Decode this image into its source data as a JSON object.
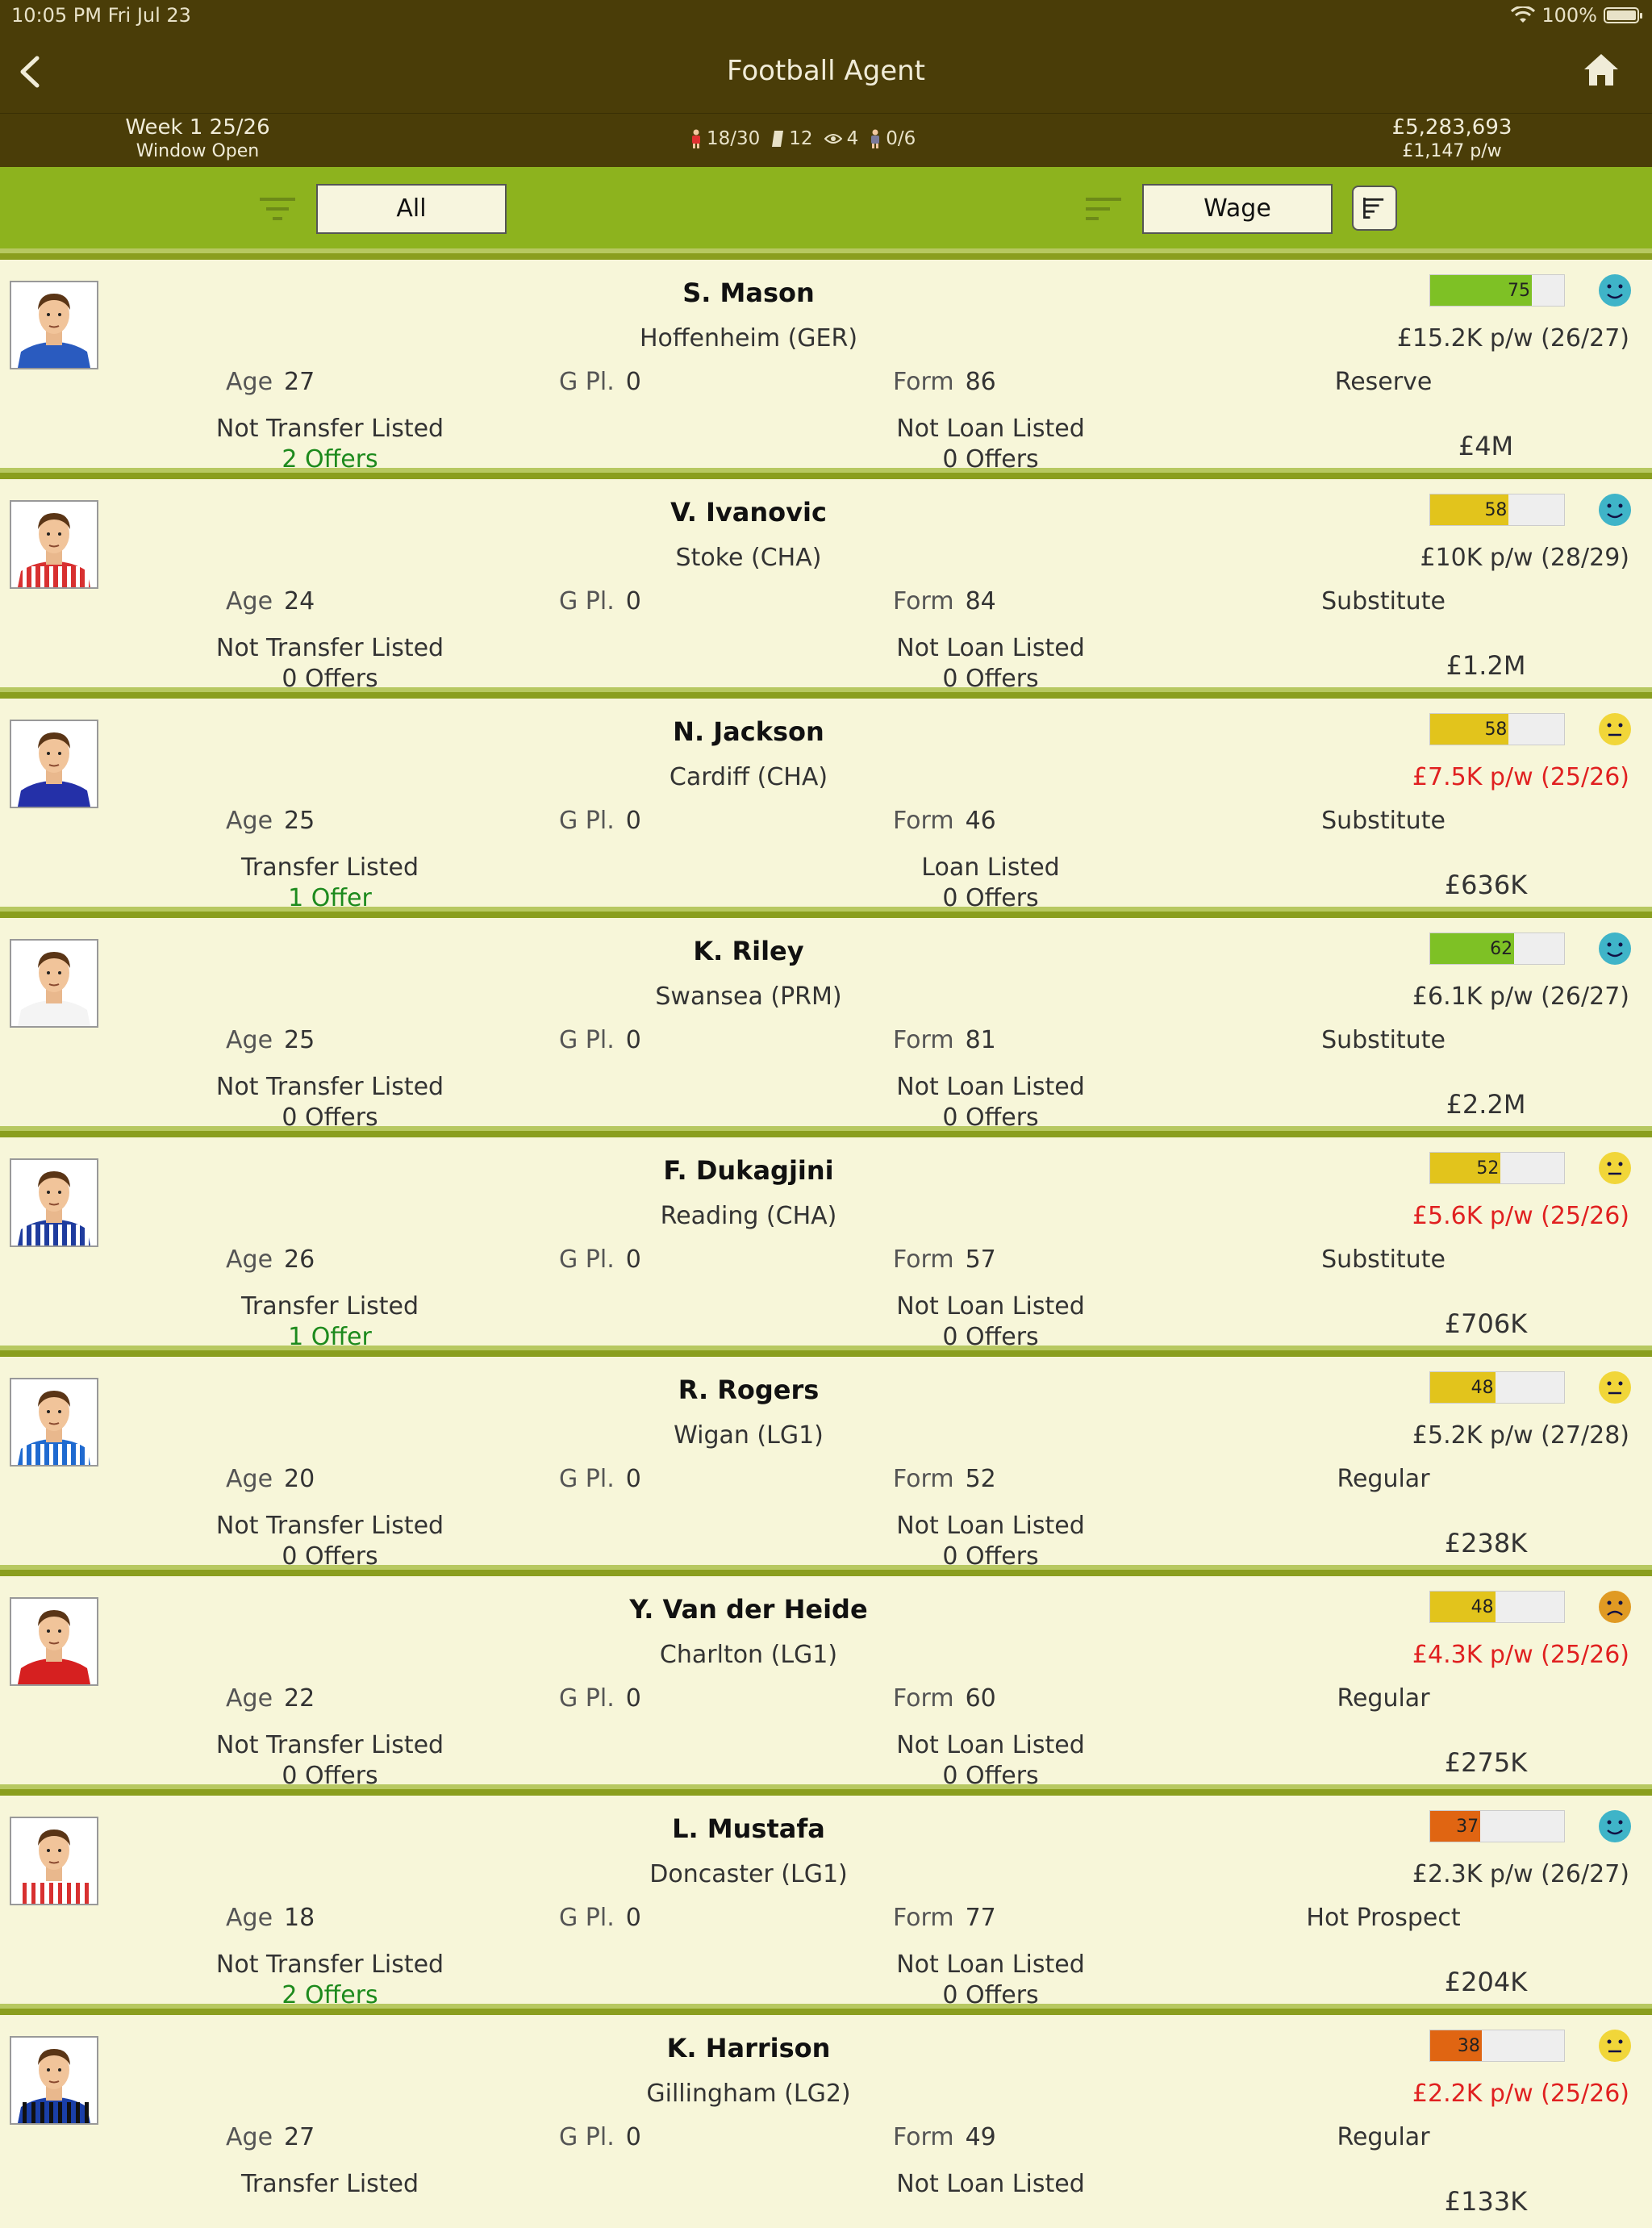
{
  "status": {
    "time": "10:05 PM   Fri Jul 23",
    "battery": "100%"
  },
  "header": {
    "title": "Football Agent"
  },
  "info": {
    "week": "Week 1 25/26",
    "window": "Window Open",
    "clients": "18/30",
    "contracts": "12",
    "watching": "4",
    "scouts": "0/6",
    "balance": "£5,283,693",
    "income": "£1,147 p/w"
  },
  "filters": {
    "filter_value": "All",
    "sort_value": "Wage"
  },
  "colors": {
    "green_bar": "#7ec125",
    "yellow_bar": "#e2c41c",
    "orange_bar": "#e06512",
    "happy": "#3fb4c8",
    "neutral": "#f1d639",
    "sad": "#e09a23"
  },
  "players": [
    {
      "name": "S. Mason",
      "club": "Hoffenheim (GER)",
      "age": "27",
      "gpl": "0",
      "form": "86",
      "rating": 75,
      "rating_color": "green",
      "wage": "£15.2K p/w (26/27)",
      "wage_warn": false,
      "mood": "happy",
      "status": "Reserve",
      "transfer": "Not Transfer Listed",
      "transfer_offers": "2 Offers",
      "transfer_green": true,
      "loan": "Not Loan Listed",
      "loan_offers": "0 Offers",
      "value": "£4M",
      "kit": [
        "#2a5bbf",
        "#2a5bbf"
      ]
    },
    {
      "name": "V. Ivanovic",
      "club": "Stoke (CHA)",
      "age": "24",
      "gpl": "0",
      "form": "84",
      "rating": 58,
      "rating_color": "yellow",
      "wage": "£10K p/w (28/29)",
      "wage_warn": false,
      "mood": "happy",
      "status": "Substitute",
      "transfer": "Not Transfer Listed",
      "transfer_offers": "0 Offers",
      "transfer_green": false,
      "loan": "Not Loan Listed",
      "loan_offers": "0 Offers",
      "value": "£1.2M",
      "kit": [
        "#d83030",
        "#ffffff"
      ]
    },
    {
      "name": "N. Jackson",
      "club": "Cardiff (CHA)",
      "age": "25",
      "gpl": "0",
      "form": "46",
      "rating": 58,
      "rating_color": "yellow",
      "wage": "£7.5K p/w (25/26)",
      "wage_warn": true,
      "mood": "neutral",
      "status": "Substitute",
      "transfer": "Transfer Listed",
      "transfer_offers": "1 Offer",
      "transfer_green": true,
      "loan": "Loan Listed",
      "loan_offers": "0 Offers",
      "value": "£636K",
      "kit": [
        "#2430a8",
        "#2430a8"
      ]
    },
    {
      "name": "K. Riley",
      "club": "Swansea (PRM)",
      "age": "25",
      "gpl": "0",
      "form": "81",
      "rating": 62,
      "rating_color": "green",
      "wage": "£6.1K p/w (26/27)",
      "wage_warn": false,
      "mood": "happy",
      "status": "Substitute",
      "transfer": "Not Transfer Listed",
      "transfer_offers": "0 Offers",
      "transfer_green": false,
      "loan": "Not Loan Listed",
      "loan_offers": "0 Offers",
      "value": "£2.2M",
      "kit": [
        "#f4f4f4",
        "#f4f4f4"
      ]
    },
    {
      "name": "F. Dukagjini",
      "club": "Reading (CHA)",
      "age": "26",
      "gpl": "0",
      "form": "57",
      "rating": 52,
      "rating_color": "yellow",
      "wage": "£5.6K p/w (25/26)",
      "wage_warn": true,
      "mood": "neutral",
      "status": "Substitute",
      "transfer": "Transfer Listed",
      "transfer_offers": "1 Offer",
      "transfer_green": true,
      "loan": "Not Loan Listed",
      "loan_offers": "0 Offers",
      "value": "£706K",
      "kit": [
        "#1f3c9e",
        "#ffffff"
      ]
    },
    {
      "name": "R. Rogers",
      "club": "Wigan (LG1)",
      "age": "20",
      "gpl": "0",
      "form": "52",
      "rating": 48,
      "rating_color": "yellow",
      "wage": "£5.2K p/w (27/28)",
      "wage_warn": false,
      "mood": "neutral",
      "status": "Regular",
      "transfer": "Not Transfer Listed",
      "transfer_offers": "0 Offers",
      "transfer_green": false,
      "loan": "Not Loan Listed",
      "loan_offers": "0 Offers",
      "value": "£238K",
      "kit": [
        "#1f6ad0",
        "#ffffff"
      ]
    },
    {
      "name": "Y. Van der Heide",
      "club": "Charlton (LG1)",
      "age": "22",
      "gpl": "0",
      "form": "60",
      "rating": 48,
      "rating_color": "yellow",
      "wage": "£4.3K p/w (25/26)",
      "wage_warn": true,
      "mood": "sad",
      "status": "Regular",
      "transfer": "Not Transfer Listed",
      "transfer_offers": "0 Offers",
      "transfer_green": false,
      "loan": "Not Loan Listed",
      "loan_offers": "0 Offers",
      "value": "£275K",
      "kit": [
        "#d62020",
        "#d62020"
      ]
    },
    {
      "name": "L. Mustafa",
      "club": "Doncaster (LG1)",
      "age": "18",
      "gpl": "0",
      "form": "77",
      "rating": 37,
      "rating_color": "orange",
      "wage": "£2.3K p/w (26/27)",
      "wage_warn": false,
      "mood": "happy",
      "status": "Hot Prospect",
      "transfer": "Not Transfer Listed",
      "transfer_offers": "2 Offers",
      "transfer_green": true,
      "loan": "Not Loan Listed",
      "loan_offers": "0 Offers",
      "value": "£204K",
      "kit": [
        "#ffffff",
        "#d83030"
      ]
    },
    {
      "name": "K. Harrison",
      "club": "Gillingham (LG2)",
      "age": "27",
      "gpl": "0",
      "form": "49",
      "rating": 38,
      "rating_color": "orange",
      "wage": "£2.2K p/w (25/26)",
      "wage_warn": true,
      "mood": "neutral",
      "status": "Regular",
      "transfer": "Transfer Listed",
      "transfer_offers": "",
      "transfer_green": false,
      "loan": "Not Loan Listed",
      "loan_offers": "",
      "value": "£133K",
      "kit": [
        "#1a3fa8",
        "#111111"
      ]
    }
  ],
  "labels": {
    "age": "Age",
    "gpl": "G Pl.",
    "form": "Form"
  }
}
